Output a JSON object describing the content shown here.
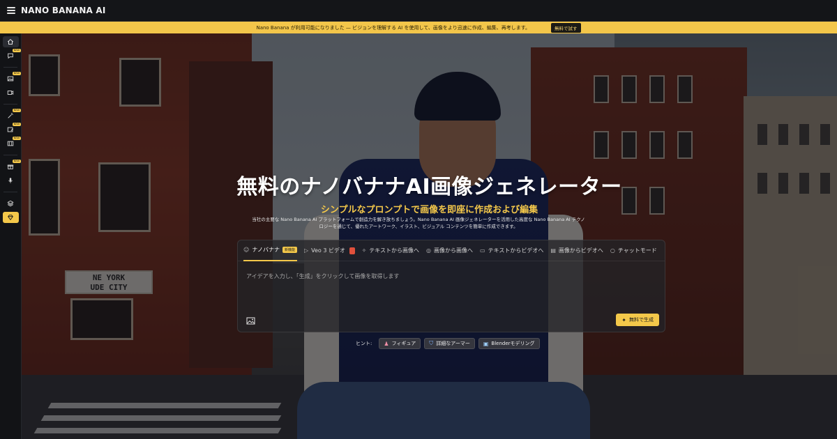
{
  "app": {
    "brand": "NANO BANANA AI"
  },
  "announcement": {
    "text": "Nano Banana が利用可能になりました — ビジョンを理解する AI を使用して、画像をより迅速に作成、編集、再考します。",
    "cta": "無料で試す"
  },
  "sidebar": {
    "items": [
      {
        "icon": "home-icon",
        "badge": ""
      },
      {
        "icon": "chat-icon",
        "badge": "NEW"
      },
      {
        "icon": "image-icon",
        "badge": "NEW"
      },
      {
        "icon": "video-icon",
        "badge": ""
      },
      {
        "icon": "magic-icon",
        "badge": "NEW"
      },
      {
        "icon": "image-edit-icon",
        "badge": "NEW"
      },
      {
        "icon": "gallery-icon",
        "badge": "NEW"
      },
      {
        "icon": "gift-icon",
        "badge": "NEW"
      },
      {
        "icon": "mic-icon",
        "badge": ""
      },
      {
        "icon": "layers-icon",
        "badge": ""
      },
      {
        "icon": "gem-icon",
        "badge": ""
      }
    ]
  },
  "hero": {
    "title": "無料のナノバナナAI画像ジェネレーター",
    "subtitle": "シンプルなプロンプトで画像を即座に作成および編集",
    "description": "当社の主要な Nano Banana AI プラットフォームで創造力を解き放ちましょう。Nano Banana AI 画像ジェネレーターを活用した高度な Nano Banana AI テクノロジーを通じて、優れたアートワーク、イラスト、ビジュアル コンテンツを簡単に作成できます。",
    "background_sign": "NE YORK\nUDE CITY"
  },
  "panel": {
    "tabs": [
      {
        "label": "ナノバナナ",
        "icon": "banana-icon",
        "badge": "新機能"
      },
      {
        "label": "Veo 3 ビデオ",
        "icon": "play-icon",
        "badge": ""
      },
      {
        "label": "テキストから画像へ",
        "icon": "magic-icon",
        "badge": ""
      },
      {
        "label": "画像から画像へ",
        "icon": "camera-icon",
        "badge": ""
      },
      {
        "label": "テキストからビデオへ",
        "icon": "video-icon",
        "badge": ""
      },
      {
        "label": "画像からビデオへ",
        "icon": "film-icon",
        "badge": ""
      },
      {
        "label": "チャットモード",
        "icon": "chat-icon",
        "badge": ""
      }
    ],
    "placeholder": "アイデアを入力し、「生成」をクリックして画像を取得します",
    "generate_label": "無料で生成"
  },
  "hints": {
    "label": "ヒント:",
    "chips": [
      {
        "label": "フィギュア",
        "icon": "figure-icon"
      },
      {
        "label": "詳細なアーマー",
        "icon": "shield-icon"
      },
      {
        "label": "Blenderモデリング",
        "icon": "cube-icon"
      }
    ]
  },
  "colors": {
    "accent": "#f4c84a",
    "topbar": "#141518",
    "sidebar": "#121316"
  }
}
